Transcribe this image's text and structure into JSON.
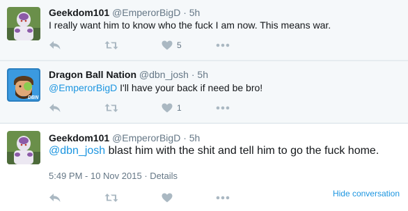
{
  "tweets": [
    {
      "fullname": "Geekdom101",
      "username": "@EmperorBigD",
      "separator": "·",
      "time": "5h",
      "text": "I really want him to know who the fuck I am now. This means war.",
      "like_count": "5"
    },
    {
      "fullname": "Dragon Ball Nation",
      "username": "@dbn_josh",
      "separator": "·",
      "time": "5h",
      "mention": "@EmperorBigD",
      "text": " I'll have your back if need be bro!",
      "like_count": "1"
    },
    {
      "fullname": "Geekdom101",
      "username": "@EmperorBigD",
      "separator": "·",
      "time": "5h",
      "mention": "@dbn_josh",
      "text": " blast him with the shit and tell him to go the fuck home.",
      "timestamp": "5:49 PM - 10 Nov 2015",
      "meta_separator": "·",
      "details_label": "Details",
      "like_count": ""
    }
  ],
  "hide_conversation_label": "Hide conversation",
  "icons": {
    "reply": "reply-icon",
    "retweet": "retweet-icon",
    "like": "heart-icon",
    "more": "more-icon"
  },
  "colors": {
    "link": "#1b95e0",
    "action_gray": "#aab8c2",
    "context_bg": "#f5f8fa"
  }
}
